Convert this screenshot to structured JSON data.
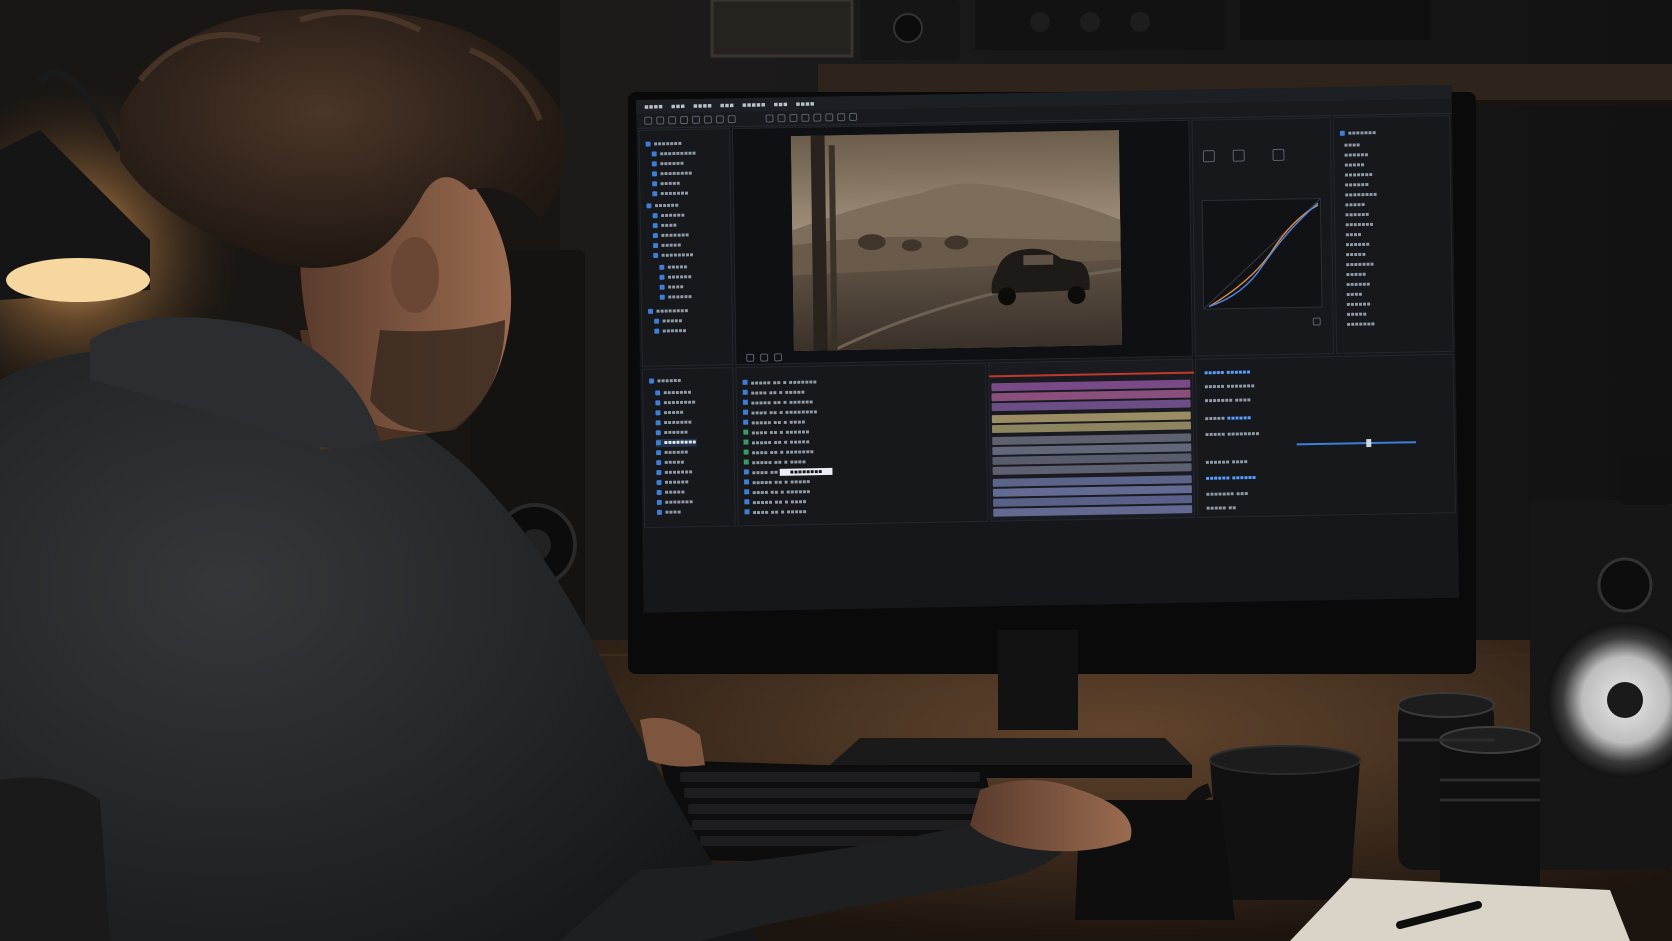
{
  "scene": {
    "colors": {
      "wall": "#1a1816",
      "desk": "#2b1f16",
      "hoodie": "#232323",
      "hair": "#3a2a20",
      "skin": "#8a5e46",
      "lamp_glow": "#f4c37a",
      "monitor_bezel": "#0a0a0b",
      "ui_accent": "#3d7fd8",
      "sepia_sky": "#a39078",
      "sepia_road": "#55483b"
    },
    "icons": [
      "desk-lamp-icon",
      "speaker-icon",
      "coffee-mug-icon",
      "camera-lens-icon",
      "keyboard-icon",
      "mouse-icon",
      "notebook-icon",
      "pen-icon"
    ]
  }
}
